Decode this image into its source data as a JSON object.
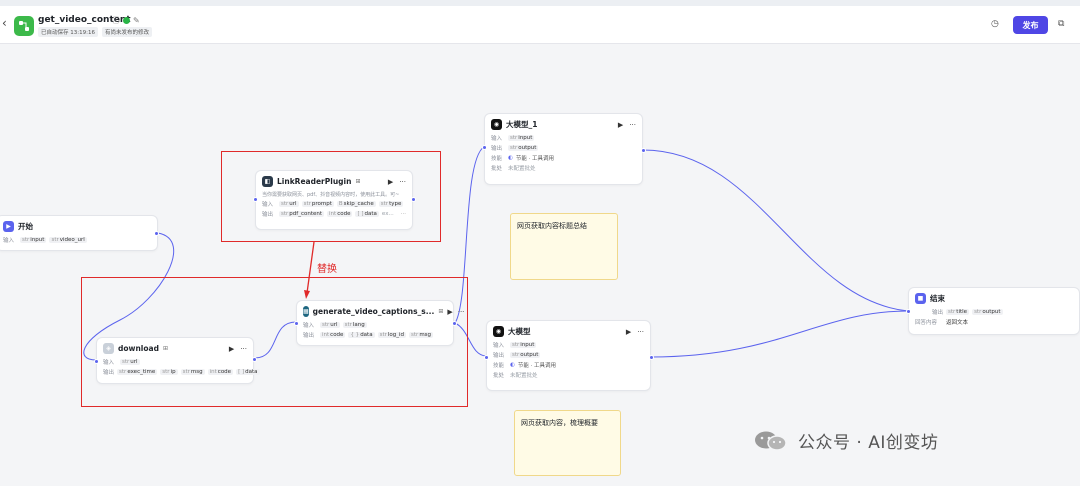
{
  "header": {
    "back_icon": "chevron-left-icon",
    "app_icon": "workflow-icon",
    "title": "get_video_content",
    "autosave": "已自动保存 13:19:16",
    "unpublished": "有尚未发布的修改",
    "publish_label": "发布"
  },
  "nodes": {
    "start": {
      "title": "开始",
      "input_label": "输入",
      "inputs": [
        "input",
        "video_url"
      ]
    },
    "link_reader": {
      "title": "LinkReaderPlugin",
      "desc": "当你需要获取网页、pdf、抖音视频内容时，使用此工具。可~",
      "input_label": "输入",
      "inputs": [
        "url",
        "prompt",
        "skip_cache",
        "type"
      ],
      "output_label": "输出",
      "outputs": [
        "pdf_content",
        "code",
        "data"
      ],
      "outputs_extra": "ex..."
    },
    "download": {
      "title": "download",
      "input_label": "输入",
      "inputs": [
        "url"
      ],
      "output_label": "输出",
      "outputs": [
        "exec_time",
        "ip",
        "msg",
        "code",
        "data"
      ]
    },
    "captions": {
      "title": "generate_video_captions_s...",
      "input_label": "输入",
      "inputs": [
        "url",
        "lang"
      ],
      "output_label": "输出",
      "outputs": [
        "code",
        "data",
        "log_id",
        "msg"
      ]
    },
    "llm1": {
      "title": "大模型_1",
      "input_label": "输入",
      "inputs": [
        "input"
      ],
      "output_label": "输出",
      "outputs": [
        "output"
      ],
      "skill_label": "技能",
      "skill_value": "节能 · 工具调用",
      "batch_label": "批处",
      "batch_value": "未配置批处"
    },
    "llm2": {
      "title": "大模型",
      "input_label": "输入",
      "inputs": [
        "input"
      ],
      "output_label": "输出",
      "outputs": [
        "output"
      ],
      "skill_label": "技能",
      "skill_value": "节能 · 工具调用",
      "batch_label": "批处",
      "batch_value": "未配置批处"
    },
    "end": {
      "title": "结束",
      "output_label": "输出",
      "outputs": [
        "title",
        "output"
      ],
      "answer_label": "回答内容",
      "answer_value": "返回文本"
    }
  },
  "notes": {
    "note1": "网页获取内容标题总结",
    "note2": "网页获取内容，梳理概要"
  },
  "annotation": {
    "replace_label": "替换"
  },
  "watermark": {
    "text": "公众号 · AI创变坊"
  },
  "colors": {
    "accent": "#4f46e5",
    "edge": "#5b63ee",
    "highlight": "#e02a2a",
    "note_bg": "#fffbe6"
  }
}
